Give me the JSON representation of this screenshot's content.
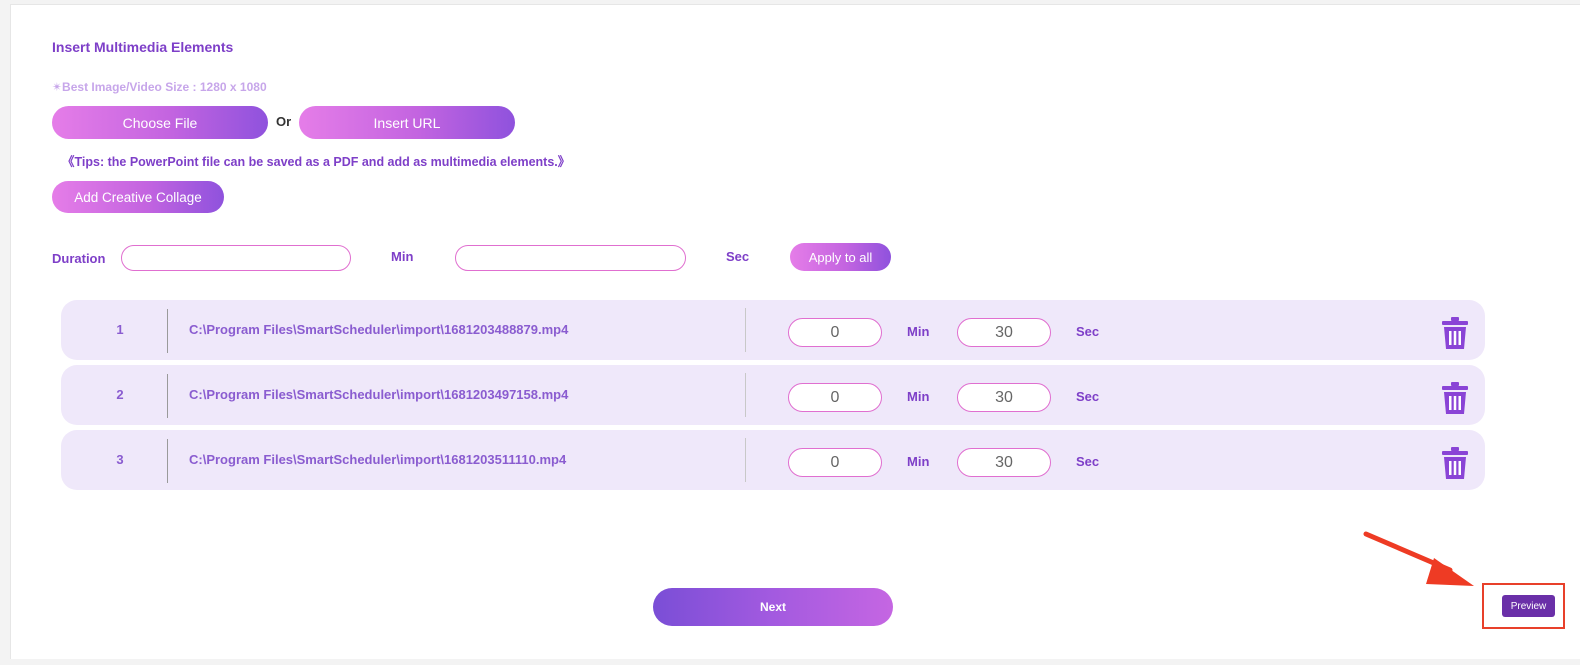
{
  "header": {
    "title": "Insert Multimedia Elements",
    "size_note": "✴Best Image/Video Size : 1280 x 1080"
  },
  "upload": {
    "choose_file_label": "Choose File",
    "or_label": "Or",
    "insert_url_label": "Insert URL",
    "tips": "《Tips: the PowerPoint file can be saved as a PDF and add as multimedia elements.》",
    "add_collage_label": "Add Creative Collage"
  },
  "duration": {
    "label": "Duration",
    "min_value": "",
    "min_label": "Min",
    "sec_value": "",
    "sec_label": "Sec",
    "apply_label": "Apply to all"
  },
  "files": [
    {
      "index": "1",
      "path": "C:\\Program Files\\SmartScheduler\\import\\1681203488879.mp4",
      "min": "0",
      "min_label": "Min",
      "sec": "30",
      "sec_label": "Sec",
      "delete_icon": "trash-icon"
    },
    {
      "index": "2",
      "path": "C:\\Program Files\\SmartScheduler\\import\\1681203497158.mp4",
      "min": "0",
      "min_label": "Min",
      "sec": "30",
      "sec_label": "Sec",
      "delete_icon": "trash-icon"
    },
    {
      "index": "3",
      "path": "C:\\Program Files\\SmartScheduler\\import\\1681203511110.mp4",
      "min": "0",
      "min_label": "Min",
      "sec": "30",
      "sec_label": "Sec",
      "delete_icon": "trash-icon"
    }
  ],
  "footer": {
    "next_label": "Next",
    "preview_label": "Preview"
  },
  "annotation": {
    "highlight_color": "#e8402a",
    "arrow_icon": "red-arrow-icon"
  },
  "colors": {
    "accent": "#7e3fc8",
    "row_background": "#efe8fa",
    "input_border": "#e06fd0",
    "trash": "#8a44d6"
  }
}
